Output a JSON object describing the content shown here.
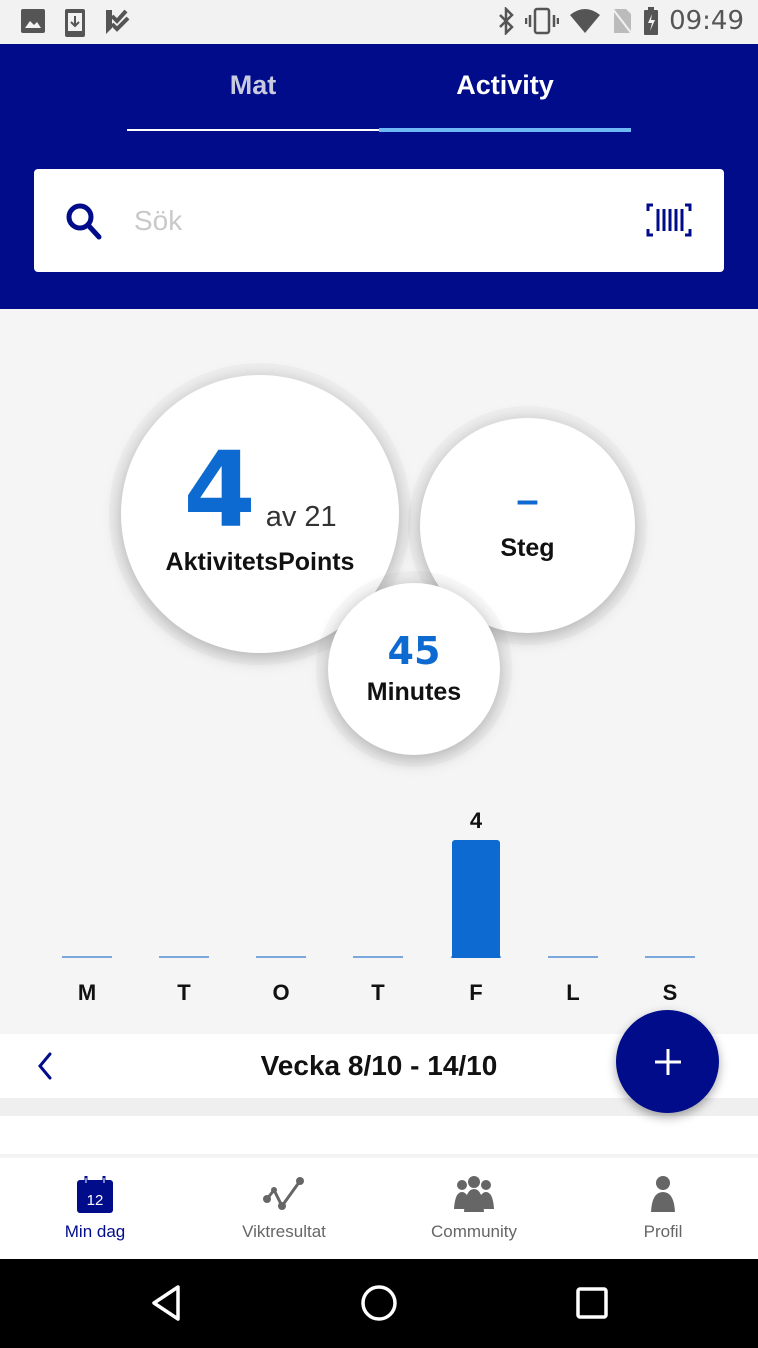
{
  "status_bar": {
    "time": "09:49",
    "left_icons": [
      "image-icon",
      "download-icon",
      "checklist-icon"
    ],
    "right_icons": [
      "bluetooth-icon",
      "vibrate-icon",
      "wifi-icon",
      "no-sim-icon",
      "battery-charging-icon"
    ]
  },
  "tabs": [
    {
      "label": "Mat",
      "active": false
    },
    {
      "label": "Activity",
      "active": true
    }
  ],
  "search": {
    "placeholder": "Sök",
    "value": "",
    "icon": "search-icon",
    "scan_icon": "barcode-icon"
  },
  "stats": {
    "points": {
      "value": "4",
      "of_text": "av 21",
      "label": "AktivitetsPoints"
    },
    "steps": {
      "value": "–",
      "label": "Steg"
    },
    "minutes": {
      "value": "45",
      "label": "Minutes"
    }
  },
  "chart_data": {
    "type": "bar",
    "title": "",
    "xlabel": "",
    "ylabel": "",
    "categories": [
      "M",
      "T",
      "O",
      "T",
      "F",
      "L",
      "S"
    ],
    "values": [
      0,
      0,
      0,
      0,
      4,
      0,
      0
    ],
    "value_labels": [
      "",
      "",
      "",
      "",
      "4",
      "",
      ""
    ],
    "ylim": [
      0,
      4
    ],
    "grid": false
  },
  "week": {
    "label": "Vecka 8/10 - 14/10",
    "prev_icon": "chevron-left-icon"
  },
  "fab": {
    "icon": "plus-icon"
  },
  "colors": {
    "brand": "#000c8a",
    "accent": "#0d6ad0",
    "tab_indicator": "#6eb8f5"
  },
  "bottom_nav": [
    {
      "label": "Min dag",
      "icon": "calendar-icon",
      "icon_text": "12",
      "active": true
    },
    {
      "label": "Viktresultat",
      "icon": "chart-line-icon",
      "active": false
    },
    {
      "label": "Community",
      "icon": "community-icon",
      "active": false
    },
    {
      "label": "Profil",
      "icon": "profile-icon",
      "active": false
    }
  ],
  "system_nav": [
    "back-icon",
    "home-icon",
    "recents-icon"
  ]
}
